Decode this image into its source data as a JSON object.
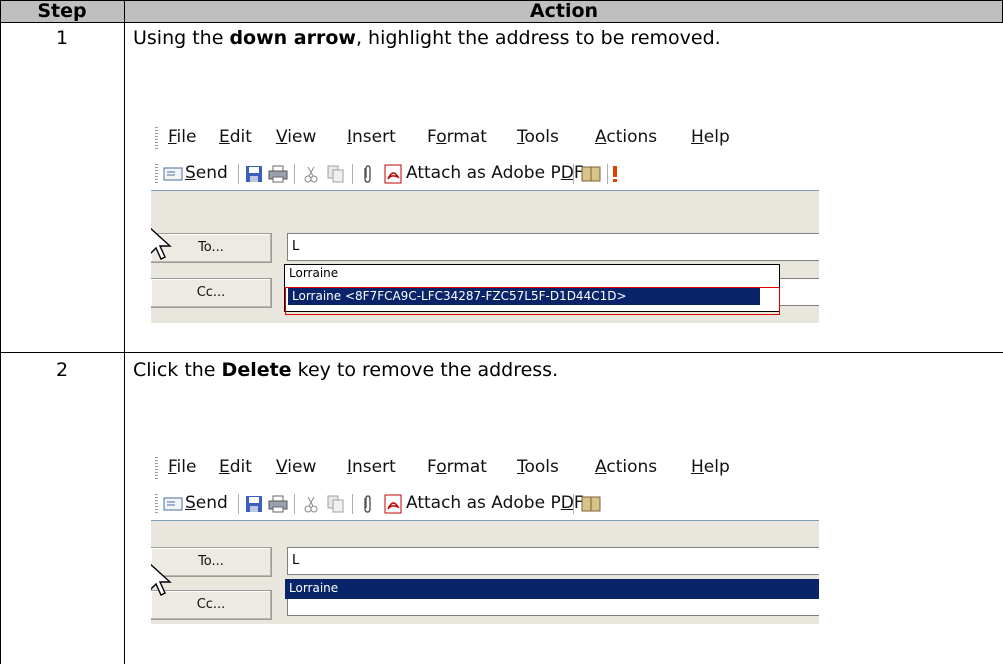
{
  "table": {
    "header": {
      "step": "Step",
      "action": "Action"
    },
    "rows": [
      {
        "step": "1",
        "instruction_pre": "Using the ",
        "instruction_bold": "down arrow",
        "instruction_post": ", highlight the address to be removed."
      },
      {
        "step": "2",
        "instruction_pre": "Click the ",
        "instruction_bold": "Delete",
        "instruction_post": " key to remove the address."
      }
    ]
  },
  "screenshot": {
    "menu": [
      {
        "pre": "",
        "key": "F",
        "post": "ile"
      },
      {
        "pre": "",
        "key": "E",
        "post": "dit"
      },
      {
        "pre": "",
        "key": "V",
        "post": "iew"
      },
      {
        "pre": "",
        "key": "I",
        "post": "nsert"
      },
      {
        "pre": "F",
        "key": "o",
        "post": "rmat"
      },
      {
        "pre": "",
        "key": "T",
        "post": "ools"
      },
      {
        "pre": "",
        "key": "A",
        "post": "ctions"
      },
      {
        "pre": "",
        "key": "H",
        "post": "elp"
      }
    ],
    "toolbar": {
      "send_pre": "",
      "send_key": "S",
      "send_post": "end",
      "attach_pre": "Attach as Adobe P",
      "attach_key": "D",
      "attach_post": "F"
    },
    "to_button": "To...",
    "cc_button": "Cc...",
    "to_value": "L",
    "step1_dropdown": {
      "plain_item": "Lorraine",
      "selected_item": "Lorraine   <8F7FCA9C-LFC34287-FZC57L5F-D1D44C1D>"
    },
    "step2_dropdown": {
      "selected_item": "Lorraine"
    }
  },
  "colors": {
    "header_bg": "#bfbfbf",
    "highlight": "#0a246a",
    "annotation": "#e00000"
  }
}
